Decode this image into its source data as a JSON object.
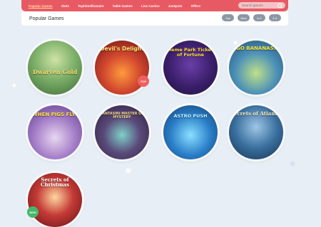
{
  "nav": {
    "items": [
      "Popular Games",
      "Slots",
      "Tophitmillionaire",
      "Table Games",
      "Live Casino",
      "Jackpots",
      "Offers"
    ],
    "active_index": 0
  },
  "search": {
    "placeholder": "Search games"
  },
  "section": {
    "title": "Popular Games"
  },
  "filters": [
    "Top",
    "New",
    "A-Z",
    "Z-A"
  ],
  "games": [
    {
      "title": "Dwarven Gold",
      "badge": ""
    },
    {
      "title": "Devil's Delight",
      "badge": "TOP"
    },
    {
      "title": "Theme Park Tickets of Fortune",
      "badge": ""
    },
    {
      "title": "GO BANANAS!",
      "badge": ""
    },
    {
      "title": "WHEN PIGS FLY!",
      "badge": ""
    },
    {
      "title": "FANTASINI MASTER OF MYSTERY",
      "badge": ""
    },
    {
      "title": "ASTRO PUSH",
      "badge": ""
    },
    {
      "title": "Secrets of Atlantis",
      "badge": ""
    },
    {
      "title": "Secrets of Christmas",
      "badge": "NEW"
    }
  ],
  "colors": {
    "brand": "#e85a63",
    "pill": "#8d97a3",
    "background": "#e8eef5"
  }
}
